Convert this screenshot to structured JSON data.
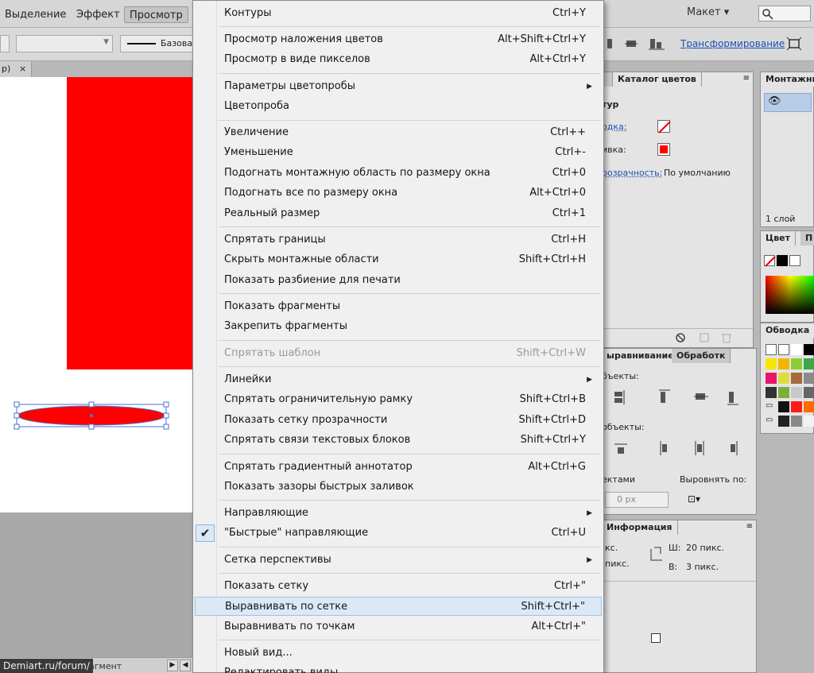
{
  "menubar": {
    "items": [
      {
        "label": "Выделение"
      },
      {
        "label": "Эффект"
      },
      {
        "label": "Просмотр"
      }
    ],
    "workspace": "Макет ▾",
    "search_icon": "search-icon"
  },
  "control_bar": {
    "stroke_label": "Базовая",
    "transform_link": "Трансформирование"
  },
  "doc_tab": {
    "label": "р)",
    "close": "×"
  },
  "status": {
    "watermark": "Demiart.ru/forum/",
    "frag": "агмент"
  },
  "colors": {
    "fill": "#ff0000",
    "accent": "#1f4fb4",
    "hover": "#dbe9f7"
  },
  "panels": {
    "color_catalog_tab": "Каталог цветов",
    "appearance": {
      "title": "тур",
      "stroke_label": "одка:",
      "fill_label": "ивка:",
      "opacity_label": "розрачность:",
      "opacity_value": "По умолчанию"
    },
    "artboards": {
      "tab": "Монтажны",
      "layers_count": "1 слой"
    },
    "color": {
      "tab": "Цвет",
      "tab2": "П"
    },
    "stroke": {
      "tab": "Обводка"
    },
    "align": {
      "tab": "ыравнивание",
      "tab2": "Обработк",
      "objects_label": "бъекты:",
      "distribute_label": "объекты:",
      "spacing_label": "ектами",
      "align_to_label": "Выровнять по:",
      "spacing_value": "0 px"
    },
    "info": {
      "tab": "Информация",
      "x_label": "кс.",
      "y_label": "пикс.",
      "w_label": "Ш:",
      "w_value": "20 пикс.",
      "h_label": "В:",
      "h_value": "3 пикс."
    }
  },
  "dropdown": {
    "items": [
      {
        "label": "Контуры",
        "shortcut": "Ctrl+Y"
      },
      {
        "label": "Просмотр наложения цветов",
        "shortcut": "Alt+Shift+Ctrl+Y"
      },
      {
        "label": "Просмотр в виде пикселов",
        "shortcut": "Alt+Ctrl+Y"
      },
      {
        "label": "Параметры цветопробы",
        "shortcut": ""
      },
      {
        "label": "Цветопроба",
        "shortcut": ""
      },
      {
        "label": "Увеличение",
        "shortcut": "Ctrl++"
      },
      {
        "label": "Уменьшение",
        "shortcut": "Ctrl+-"
      },
      {
        "label": "Подогнать монтажную область по размеру окна",
        "shortcut": "Ctrl+0"
      },
      {
        "label": "Подогнать все по размеру окна",
        "shortcut": "Alt+Ctrl+0"
      },
      {
        "label": "Реальный размер",
        "shortcut": "Ctrl+1"
      },
      {
        "label": "Спрятать границы",
        "shortcut": "Ctrl+H"
      },
      {
        "label": "Скрыть монтажные области",
        "shortcut": "Shift+Ctrl+H"
      },
      {
        "label": "Показать разбиение для печати",
        "shortcut": ""
      },
      {
        "label": "Показать фрагменты",
        "shortcut": ""
      },
      {
        "label": "Закрепить фрагменты",
        "shortcut": ""
      },
      {
        "label": "Спрятать шаблон",
        "shortcut": "Shift+Ctrl+W"
      },
      {
        "label": "Линейки",
        "shortcut": ""
      },
      {
        "label": "Спрятать ограничительную рамку",
        "shortcut": "Shift+Ctrl+B"
      },
      {
        "label": "Показать сетку прозрачности",
        "shortcut": "Shift+Ctrl+D"
      },
      {
        "label": "Спрятать связи текстовых блоков",
        "shortcut": "Shift+Ctrl+Y"
      },
      {
        "label": "Спрятать градиентный аннотатор",
        "shortcut": "Alt+Ctrl+G"
      },
      {
        "label": "Показать зазоры быстрых заливок",
        "shortcut": ""
      },
      {
        "label": "Направляющие",
        "shortcut": ""
      },
      {
        "label": "\"Быстрые\" направляющие",
        "shortcut": "Ctrl+U"
      },
      {
        "label": "Сетка перспективы",
        "shortcut": ""
      },
      {
        "label": "Показать сетку",
        "shortcut": "Ctrl+\""
      },
      {
        "label": "Выравнивать по сетке",
        "shortcut": "Shift+Ctrl+\""
      },
      {
        "label": "Выравнивать по точкам",
        "shortcut": "Alt+Ctrl+\""
      },
      {
        "label": "Новый вид...",
        "shortcut": ""
      },
      {
        "label": "Редактировать виды...",
        "shortcut": ""
      }
    ],
    "submenu_arrow": "▶",
    "check_mark": "✔"
  }
}
